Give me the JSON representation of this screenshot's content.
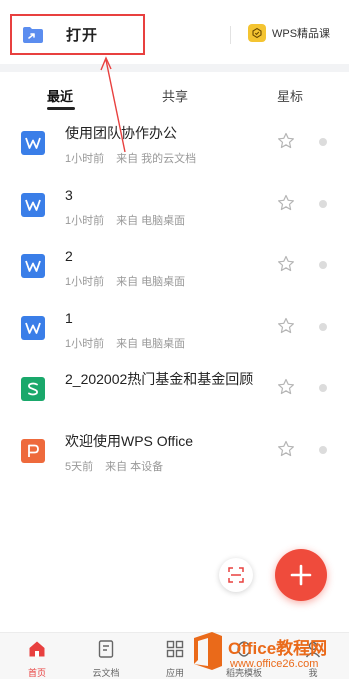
{
  "header": {
    "open_label": "打开",
    "premium_label": "WPS精品课"
  },
  "tabs": [
    {
      "label": "最近",
      "active": true
    },
    {
      "label": "共享",
      "active": false
    },
    {
      "label": "星标",
      "active": false
    }
  ],
  "files": [
    {
      "title": "使用团队协作办公",
      "time": "1小时前",
      "source": "来自 我的云文档",
      "type": "writer",
      "icon_letter": "W",
      "color": "#3a7ee8"
    },
    {
      "title": "3",
      "time": "1小时前",
      "source": "来自 电脑桌面",
      "type": "writer",
      "icon_letter": "W",
      "color": "#3a7ee8"
    },
    {
      "title": "2",
      "time": "1小时前",
      "source": "来自 电脑桌面",
      "type": "writer",
      "icon_letter": "W",
      "color": "#3a7ee8"
    },
    {
      "title": "1",
      "time": "1小时前",
      "source": "来自 电脑桌面",
      "type": "writer",
      "icon_letter": "W",
      "color": "#3a7ee8"
    },
    {
      "title": "2_202002热门基金和基金回顾",
      "time": "",
      "source": "",
      "type": "spreadsheet",
      "icon_letter": "S",
      "color": "#1aa86b"
    },
    {
      "title": "欢迎使用WPS Office",
      "time": "5天前",
      "source": "来自 本设备",
      "type": "presentation",
      "icon_letter": "P",
      "color": "#ee6a3c"
    }
  ],
  "bottom_nav": [
    {
      "label": "首页",
      "icon": "home-icon",
      "active": true
    },
    {
      "label": "云文档",
      "icon": "cloud-doc-icon",
      "active": false
    },
    {
      "label": "应用",
      "icon": "apps-grid-icon",
      "active": false
    },
    {
      "label": "稻壳模板",
      "icon": "template-icon",
      "active": false
    },
    {
      "label": "我",
      "icon": "profile-icon",
      "active": false
    }
  ],
  "watermark": {
    "line1": "Office教程网",
    "line2": "www.office26.com"
  },
  "colors": {
    "accent": "#e8403f",
    "fab": "#ef4b3c",
    "writer": "#3a7ee8",
    "spreadsheet": "#1aa86b",
    "presentation": "#ee6a3c",
    "watermark": "#ea6a1a"
  }
}
